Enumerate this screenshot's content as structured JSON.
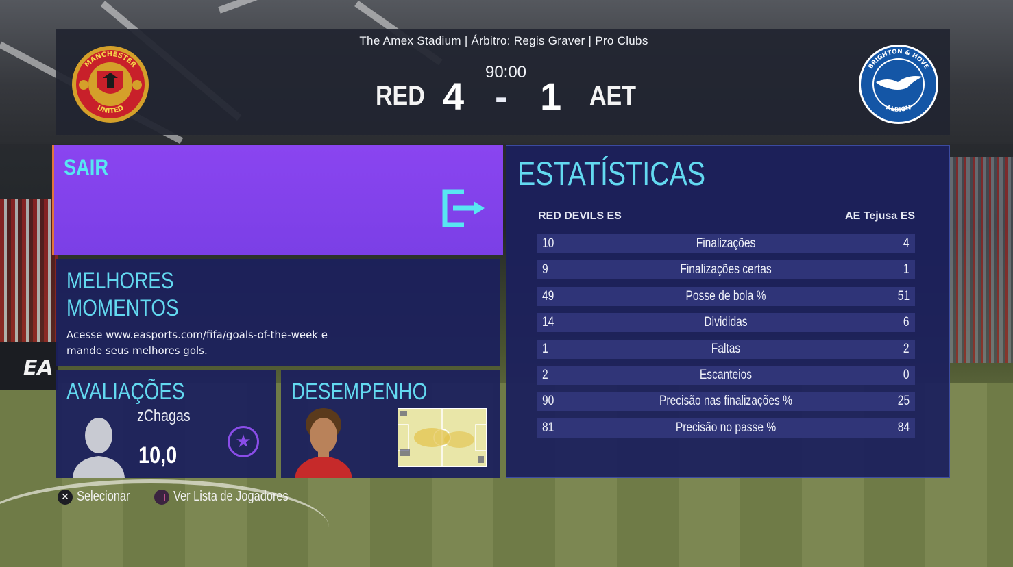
{
  "match": {
    "info": "The Amex Stadium | Árbitro: Regis Graver | Pro Clubs",
    "time": "90:00",
    "home_abbr": "RED",
    "away_abbr": "AET",
    "home_score": "4",
    "separator": "-",
    "away_score": "1",
    "home_crest_icon": "manchester-united-crest",
    "away_crest_icon": "brighton-crest",
    "home_crest_text": "MANCHESTER UNITED",
    "away_crest_text": "BRIGHTON & HOVE ALBION"
  },
  "exit": {
    "label": "SAIR",
    "icon": "exit-door-icon",
    "accent": "#58e6f2"
  },
  "highlights": {
    "title_line1": "MELHORES",
    "title_line2": "MOMENTOS",
    "text": "Acesse www.easports.com/fifa/goals-of-the-week e mande seus melhores gols."
  },
  "ratings": {
    "title": "AVALIAÇÕES",
    "player_name": "zChagas",
    "rating": "10,0",
    "icon": "star-badge-icon"
  },
  "performance": {
    "title": "DESEMPENHO",
    "icon": "heatmap-icon"
  },
  "stats": {
    "title": "ESTATÍSTICAS",
    "home_team": "RED DEVILS ES",
    "away_team": "AE Tejusa ES",
    "rows": [
      {
        "name": "Finalizações",
        "home": "10",
        "away": "4"
      },
      {
        "name": "Finalizações certas",
        "home": "9",
        "away": "1"
      },
      {
        "name": "Posse de bola %",
        "home": "49",
        "away": "51"
      },
      {
        "name": "Divididas",
        "home": "14",
        "away": "6"
      },
      {
        "name": "Faltas",
        "home": "1",
        "away": "2"
      },
      {
        "name": "Escanteios",
        "home": "2",
        "away": "0"
      },
      {
        "name": "Precisão nas finalizações %",
        "home": "90",
        "away": "25"
      },
      {
        "name": "Precisão no passe %",
        "home": "81",
        "away": "84"
      }
    ]
  },
  "controls": [
    {
      "button": "✕",
      "label": "Selecionar"
    },
    {
      "button": "□",
      "label": "Ver Lista de Jogadores"
    }
  ],
  "background": {
    "ad_text": "EA"
  },
  "colors": {
    "title_cyan": "#63d9f0",
    "exit_purple": "#8a45f0",
    "panel_navy": "#1c205c"
  }
}
